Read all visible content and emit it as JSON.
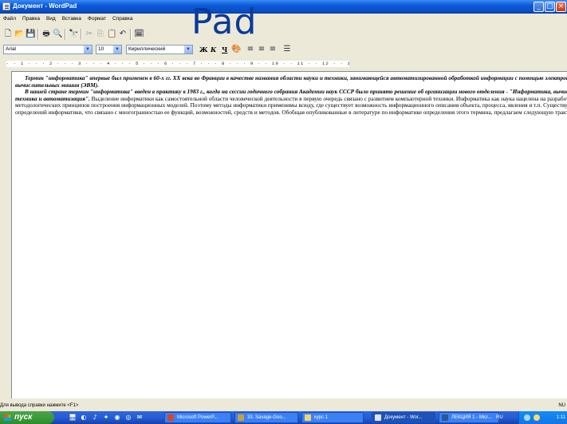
{
  "window": {
    "title": "Документ - WordPad",
    "watermark": "Pad"
  },
  "menu": [
    "Файл",
    "Правка",
    "Вид",
    "Вставка",
    "Формат",
    "Справка"
  ],
  "format_bar": {
    "font": "Arial",
    "size": "10",
    "script": "Кириллический",
    "bold_label": "Ж",
    "italic_label": "К",
    "underline_label": "Ч"
  },
  "ruler": "· · 1 · · · 2 · · · 3 · · · 4 · · · 5 · · · 6 · · · 7 · · · 8 · · · 9 · · 10 · · 11 · · 12 · · 13 · · 14 · ·15 · · 16 · · 17 · ·",
  "document": {
    "p1": "Термин \"информатика\" впервые был применен в 60-х гг. XX века во Франции в качестве названия области науки и техники, занимающейся автоматизированной обработкой информации с помощью электронных вычислительных машин (ЭВМ).",
    "p2_emph": "В нашей стране термин \"информатика\" введен в практику в 1983 г., когда на сессии годичного собрания Академии наук СССР было принято решение об организации нового отделения - \"Информатика, вычислительная техника и автоматизация\".",
    "p2_rest": " Выделение информатики как самостоятельной области человеческой деятельности в первую очередь связано с развитием компьютерной техники. Информатика как наука нацелена на разработку общих методологических принципов построения информационных моделей. Поэтому методы информатики применимы всюду, где существует возможность информационного описания объекта, процесса, явления и т.п. Существует множество определений информатики, что связано с многогранностью ее функций, возможностей, средств и методов. Обобщая опубликованные в литературе по информатике определения этого термина, предлагаем следующую трактовку:"
  },
  "status": {
    "hint": "Для вывода справки нажмите <F1>",
    "mode": "NU"
  },
  "taskbar": {
    "start": "пуск",
    "tasks": [
      "Microsoft PowerP...",
      "33. Savage-Goo...",
      "курс 1",
      "Документ - Wor...",
      "ЛЕКЦИЯ 1 - Micr..."
    ],
    "lang": "RU",
    "clock": "1:11"
  },
  "icons": {
    "titlebar": "wordpad-app-icon",
    "toolbar": [
      "new-icon",
      "open-icon",
      "save-icon",
      "print-icon",
      "print-preview-icon",
      "find-icon",
      "cut-icon",
      "copy-icon",
      "paste-icon",
      "undo-icon",
      "insert-date-icon"
    ]
  }
}
